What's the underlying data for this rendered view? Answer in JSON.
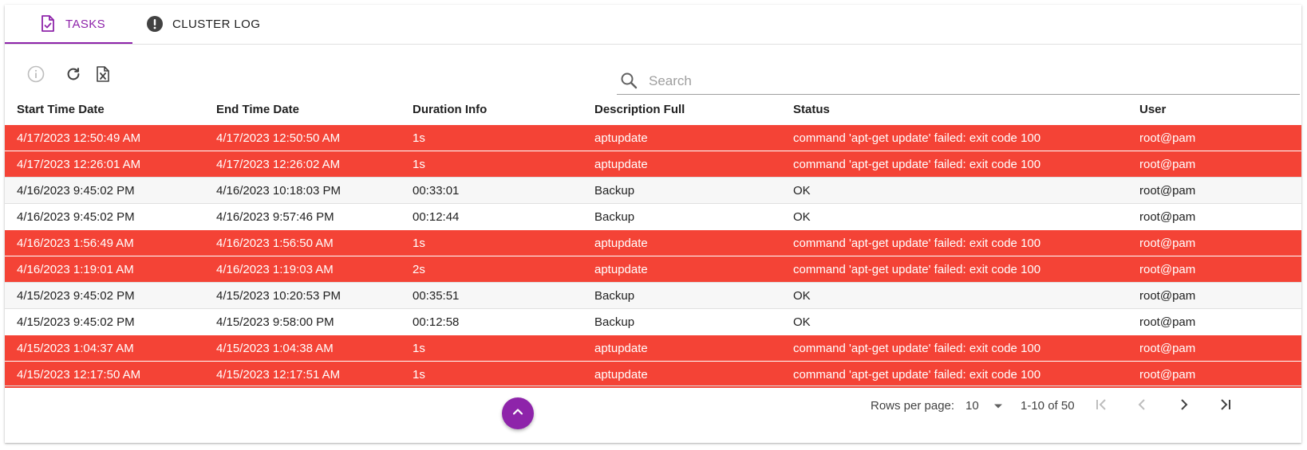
{
  "tabs": [
    {
      "label": "TASKS",
      "icon": "document-check-icon",
      "active": true
    },
    {
      "label": "CLUSTER LOG",
      "icon": "alert-circle-icon",
      "active": false
    }
  ],
  "toolbar": {
    "info_icon": "info-icon",
    "refresh_icon": "refresh-icon",
    "export_icon": "excel-export-icon"
  },
  "search": {
    "placeholder": "Search",
    "value": ""
  },
  "table": {
    "columns": [
      "Start Time Date",
      "End Time Date",
      "Duration Info",
      "Description Full",
      "Status",
      "User"
    ],
    "rows": [
      {
        "error": true,
        "cells": [
          "4/17/2023 12:50:49 AM",
          "4/17/2023 12:50:50 AM",
          "1s",
          "aptupdate",
          "command 'apt-get update' failed: exit code 100",
          "root@pam"
        ]
      },
      {
        "error": true,
        "cells": [
          "4/17/2023 12:26:01 AM",
          "4/17/2023 12:26:02 AM",
          "1s",
          "aptupdate",
          "command 'apt-get update' failed: exit code 100",
          "root@pam"
        ]
      },
      {
        "error": false,
        "cells": [
          "4/16/2023 9:45:02 PM",
          "4/16/2023 10:18:03 PM",
          "00:33:01",
          "Backup",
          "OK",
          "root@pam"
        ]
      },
      {
        "error": false,
        "cells": [
          "4/16/2023 9:45:02 PM",
          "4/16/2023 9:57:46 PM",
          "00:12:44",
          "Backup",
          "OK",
          "root@pam"
        ]
      },
      {
        "error": true,
        "cells": [
          "4/16/2023 1:56:49 AM",
          "4/16/2023 1:56:50 AM",
          "1s",
          "aptupdate",
          "command 'apt-get update' failed: exit code 100",
          "root@pam"
        ]
      },
      {
        "error": true,
        "cells": [
          "4/16/2023 1:19:01 AM",
          "4/16/2023 1:19:03 AM",
          "2s",
          "aptupdate",
          "command 'apt-get update' failed: exit code 100",
          "root@pam"
        ]
      },
      {
        "error": false,
        "cells": [
          "4/15/2023 9:45:02 PM",
          "4/15/2023 10:20:53 PM",
          "00:35:51",
          "Backup",
          "OK",
          "root@pam"
        ]
      },
      {
        "error": false,
        "cells": [
          "4/15/2023 9:45:02 PM",
          "4/15/2023 9:58:00 PM",
          "00:12:58",
          "Backup",
          "OK",
          "root@pam"
        ]
      },
      {
        "error": true,
        "cells": [
          "4/15/2023 1:04:37 AM",
          "4/15/2023 1:04:38 AM",
          "1s",
          "aptupdate",
          "command 'apt-get update' failed: exit code 100",
          "root@pam"
        ]
      },
      {
        "error": true,
        "cells": [
          "4/15/2023 12:17:50 AM",
          "4/15/2023 12:17:51 AM",
          "1s",
          "aptupdate",
          "command 'apt-get update' failed: exit code 100",
          "root@pam"
        ]
      }
    ]
  },
  "pagination": {
    "rows_per_page_label": "Rows per page:",
    "rows_per_page": "10",
    "range": "1-10 of 50"
  },
  "colors": {
    "accent": "#8e24aa",
    "error_row": "#f44336",
    "ok_row_alt": "#f7f7f7"
  },
  "fab_icon": "chevron-up-icon"
}
